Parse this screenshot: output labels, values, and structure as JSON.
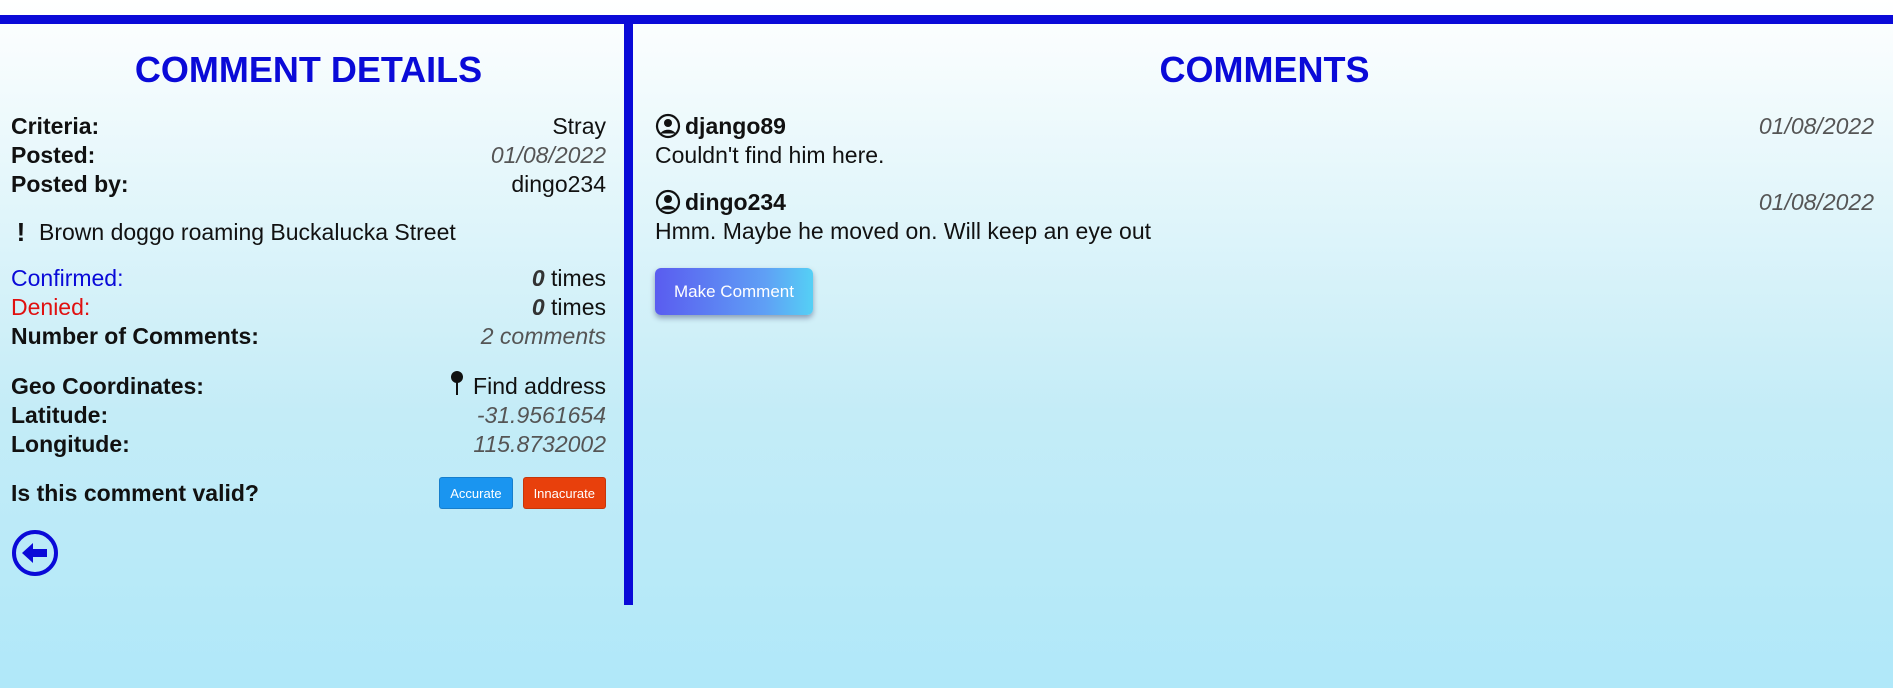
{
  "details": {
    "title": "COMMENT DETAILS",
    "criteria_label": "Criteria:",
    "criteria_value": "Stray",
    "posted_label": "Posted:",
    "posted_value": "01/08/2022",
    "posted_by_label": "Posted by:",
    "posted_by_value": "dingo234",
    "note_icon": "!",
    "note_text": "Brown doggo roaming Buckalucka Street",
    "confirmed_label": "Confirmed:",
    "confirmed_count": "0",
    "confirmed_unit": "times",
    "denied_label": "Denied:",
    "denied_count": "0",
    "denied_unit": "times",
    "num_comments_label": "Number of Comments:",
    "num_comments_value": "2 comments",
    "geo_label": "Geo Coordinates:",
    "find_address": "Find address",
    "latitude_label": "Latitude:",
    "latitude_value": "-31.9561654",
    "longitude_label": "Longitude:",
    "longitude_value": "115.8732002",
    "valid_question": "Is this comment valid?",
    "accurate_button": "Accurate",
    "inaccurate_button": "Innacurate"
  },
  "comments": {
    "title": "COMMENTS",
    "items": [
      {
        "user": "django89",
        "date": "01/08/2022",
        "text": "Couldn't find him here."
      },
      {
        "user": "dingo234",
        "date": "01/08/2022",
        "text": "Hmm. Maybe he moved on. Will keep an eye out"
      }
    ],
    "make_comment_button": "Make Comment"
  },
  "colors": {
    "accent": "#0a0ad8",
    "denied": "#e01010",
    "accurate": "#1a95f0",
    "inaccurate": "#e8400c"
  },
  "icons": [
    "exclamation-icon",
    "map-pin-icon",
    "user-circle-icon",
    "back-arrow-icon"
  ]
}
